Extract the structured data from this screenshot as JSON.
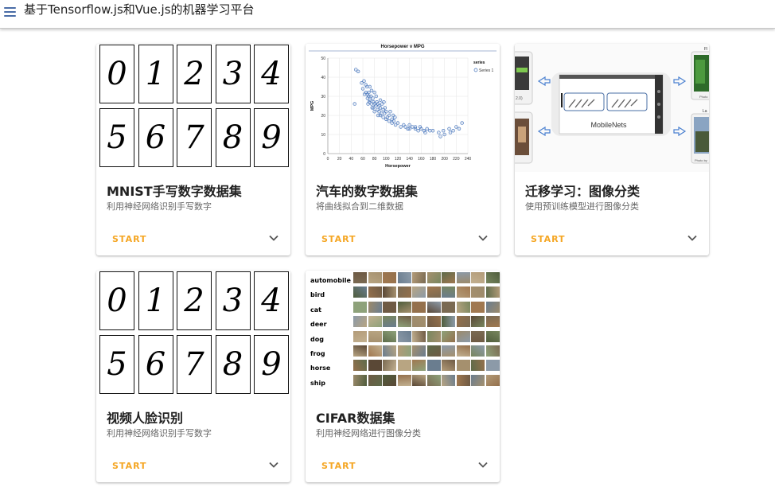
{
  "app": {
    "title": "基于Tensorflow.js和Vue.js的机器学习平台"
  },
  "colors": {
    "accent": "#f5a623",
    "menu": "#4a6da7",
    "chart_point": "#3b6cb7"
  },
  "cards": [
    {
      "title": "MNIST手写数字数据集",
      "subtitle": "利用神经网络识别手写数字",
      "action": "START",
      "media": "mnist"
    },
    {
      "title": "汽车的数字数据集",
      "subtitle": "将曲线拟合到二维数据",
      "action": "START",
      "media": "chart"
    },
    {
      "title": "迁移学习：图像分类",
      "subtitle": "使用预训练模型进行图像分类",
      "action": "START",
      "media": "mobilenets"
    },
    {
      "title": "视频人脸识别",
      "subtitle": "利用神经网络识别手写数字",
      "action": "START",
      "media": "mnist"
    },
    {
      "title": "CIFAR数据集",
      "subtitle": "利用神经网络进行图像分类",
      "action": "START",
      "media": "cifar"
    }
  ],
  "mnist": {
    "digits": [
      "0",
      "1",
      "2",
      "3",
      "4",
      "5",
      "6",
      "7",
      "8",
      "9"
    ]
  },
  "mobilenets": {
    "label": "MobileNets",
    "caption_left_top": "2.0)",
    "caption_right_top": "Fl",
    "caption_right_mid": "Photo",
    "caption_right_bottom_label": "La",
    "caption_right_bottom": "Photo by"
  },
  "cifar": {
    "classes": [
      "automobile",
      "bird",
      "cat",
      "deer",
      "dog",
      "frog",
      "horse",
      "ship"
    ]
  },
  "chart_data": {
    "type": "scatter",
    "title": "Horsepower v MPG",
    "xlabel": "Horsepower",
    "ylabel": "MPG",
    "xlim": [
      0,
      240
    ],
    "ylim": [
      0,
      50
    ],
    "x_ticks": [
      0,
      20,
      40,
      60,
      80,
      100,
      120,
      140,
      160,
      180,
      200,
      220,
      240
    ],
    "y_ticks": [
      0,
      10,
      20,
      30,
      40,
      50
    ],
    "legend": {
      "title": "series",
      "entries": [
        "Series 1"
      ],
      "placement": "top-right"
    },
    "grid": true,
    "series": [
      {
        "name": "Series 1",
        "points": [
          [
            46,
            26
          ],
          [
            48,
            44
          ],
          [
            52,
            43
          ],
          [
            58,
            37
          ],
          [
            60,
            34
          ],
          [
            62,
            38
          ],
          [
            63,
            31
          ],
          [
            65,
            36
          ],
          [
            65,
            32
          ],
          [
            67,
            35
          ],
          [
            68,
            31
          ],
          [
            68,
            29
          ],
          [
            69,
            26
          ],
          [
            70,
            30
          ],
          [
            70,
            32
          ],
          [
            71,
            27
          ],
          [
            72,
            35
          ],
          [
            72,
            28
          ],
          [
            74,
            30
          ],
          [
            75,
            33
          ],
          [
            75,
            26
          ],
          [
            76,
            24
          ],
          [
            77,
            29
          ],
          [
            78,
            27
          ],
          [
            78,
            24
          ],
          [
            80,
            32
          ],
          [
            80,
            26
          ],
          [
            80,
            22
          ],
          [
            82,
            25
          ],
          [
            83,
            30
          ],
          [
            84,
            27
          ],
          [
            85,
            23
          ],
          [
            86,
            26
          ],
          [
            86,
            20
          ],
          [
            88,
            25
          ],
          [
            88,
            22
          ],
          [
            90,
            28
          ],
          [
            90,
            24
          ],
          [
            90,
            20
          ],
          [
            92,
            21
          ],
          [
            93,
            26
          ],
          [
            95,
            23
          ],
          [
            95,
            19
          ],
          [
            96,
            27
          ],
          [
            97,
            21
          ],
          [
            98,
            24
          ],
          [
            100,
            22
          ],
          [
            100,
            18
          ],
          [
            102,
            19
          ],
          [
            105,
            20
          ],
          [
            105,
            17
          ],
          [
            107,
            22
          ],
          [
            110,
            18
          ],
          [
            110,
            16
          ],
          [
            112,
            20
          ],
          [
            113,
            17
          ],
          [
            115,
            19
          ],
          [
            116,
            15
          ],
          [
            120,
            16
          ],
          [
            125,
            14
          ],
          [
            130,
            15
          ],
          [
            133,
            14
          ],
          [
            137,
            13
          ],
          [
            140,
            15
          ],
          [
            140,
            13
          ],
          [
            145,
            14
          ],
          [
            150,
            13
          ],
          [
            150,
            14
          ],
          [
            155,
            12
          ],
          [
            158,
            14
          ],
          [
            160,
            13
          ],
          [
            165,
            12
          ],
          [
            167,
            11
          ],
          [
            170,
            13
          ],
          [
            175,
            12
          ],
          [
            180,
            12
          ],
          [
            190,
            11
          ],
          [
            193,
            9
          ],
          [
            198,
            12
          ],
          [
            200,
            10
          ],
          [
            208,
            13
          ],
          [
            210,
            11
          ],
          [
            215,
            12
          ],
          [
            220,
            14
          ],
          [
            225,
            13
          ],
          [
            230,
            16
          ]
        ]
      }
    ]
  }
}
